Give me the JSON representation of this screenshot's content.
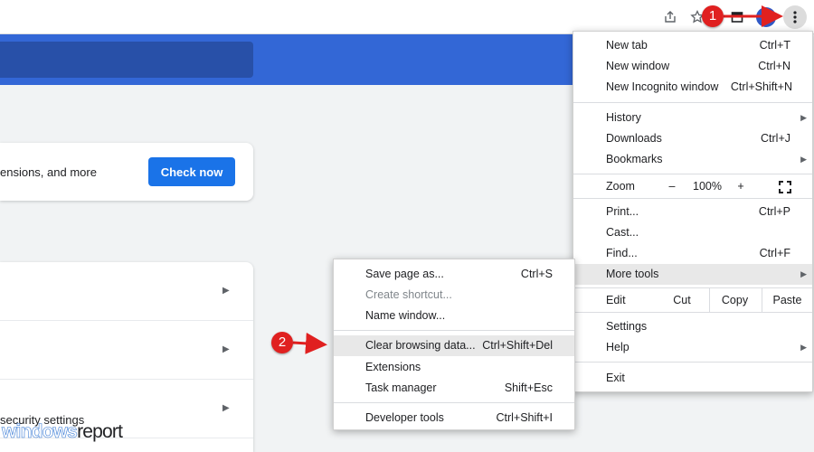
{
  "toolbar": {
    "share_icon": "share-icon",
    "bookmark_icon": "star-icon",
    "tab_search_icon": "tab-search-icon",
    "avatar": "profile-avatar",
    "menu_icon": "three-dot-menu-icon"
  },
  "safety_check": {
    "text": "ensions, and more",
    "button_label": "Check now"
  },
  "settings_list": {
    "partial_text": "security settings"
  },
  "watermark": {
    "part1": "windows",
    "part2": "report"
  },
  "main_menu": {
    "group1": [
      {
        "label": "New tab",
        "shortcut": "Ctrl+T"
      },
      {
        "label": "New window",
        "shortcut": "Ctrl+N"
      },
      {
        "label": "New Incognito window",
        "shortcut": "Ctrl+Shift+N"
      }
    ],
    "group2": [
      {
        "label": "History",
        "shortcut": ""
      },
      {
        "label": "Downloads",
        "shortcut": "Ctrl+J"
      },
      {
        "label": "Bookmarks",
        "shortcut": ""
      }
    ],
    "zoom": {
      "label": "Zoom",
      "minus": "–",
      "value": "100%",
      "plus": "+"
    },
    "group3": [
      {
        "label": "Print...",
        "shortcut": "Ctrl+P"
      },
      {
        "label": "Cast...",
        "shortcut": ""
      },
      {
        "label": "Find...",
        "shortcut": "Ctrl+F"
      },
      {
        "label": "More tools",
        "shortcut": ""
      }
    ],
    "edit": {
      "label": "Edit",
      "cut": "Cut",
      "copy": "Copy",
      "paste": "Paste"
    },
    "group4": [
      {
        "label": "Settings",
        "shortcut": ""
      },
      {
        "label": "Help",
        "shortcut": ""
      }
    ],
    "exit": {
      "label": "Exit"
    }
  },
  "more_tools_menu": {
    "group1": [
      {
        "label": "Save page as...",
        "shortcut": "Ctrl+S"
      },
      {
        "label": "Create shortcut...",
        "shortcut": ""
      },
      {
        "label": "Name window...",
        "shortcut": ""
      }
    ],
    "group2": [
      {
        "label": "Clear browsing data...",
        "shortcut": "Ctrl+Shift+Del"
      },
      {
        "label": "Extensions",
        "shortcut": ""
      },
      {
        "label": "Task manager",
        "shortcut": "Shift+Esc"
      }
    ],
    "group3": [
      {
        "label": "Developer tools",
        "shortcut": "Ctrl+Shift+I"
      }
    ]
  },
  "annotations": [
    {
      "number": "1"
    },
    {
      "number": "2"
    }
  ],
  "colors": {
    "accent_blue": "#3367d6",
    "button_blue": "#1a73e8",
    "annotation_red": "#e02020",
    "menu_highlight": "#e8e8e8"
  }
}
